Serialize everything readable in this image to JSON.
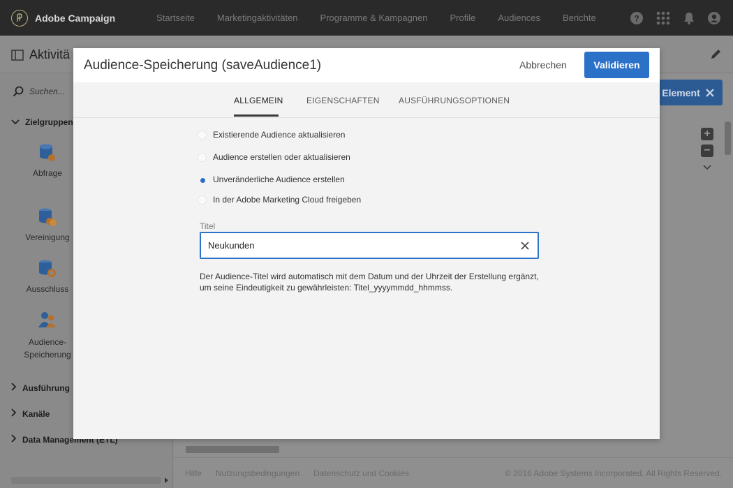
{
  "app": {
    "brand": "Adobe Campaign",
    "nav": [
      "Startseite",
      "Marketingaktivitäten",
      "Programme & Kampagnen",
      "Profile",
      "Audiences",
      "Berichte"
    ]
  },
  "background": {
    "page_title": "Aktivitä",
    "search_placeholder": "Suchen...",
    "sections": {
      "targeting": "Zielgruppenb",
      "execution": "Ausführung",
      "channels": "Kanäle",
      "data_management": "Data Management (ETL)"
    },
    "palette": {
      "query": "Abfrage",
      "union": "Vereinigung",
      "exclusion": "Ausschluss",
      "save_audience_line1": "Audience-",
      "save_audience_line2": "Speicherung"
    },
    "element_button": "Element",
    "footer": {
      "help": "Hilfe",
      "terms": "Nutzungsbedingungen",
      "privacy": "Datenschutz und Cookies",
      "copyright": "© 2016 Adobe Systems Incorporated. All Rights Reserved."
    }
  },
  "modal": {
    "title": "Audience-Speicherung (saveAudience1)",
    "cancel_label": "Abbrechen",
    "validate_label": "Validieren",
    "tabs": [
      "ALLGEMEIN",
      "EIGENSCHAFTEN",
      "AUSFÜHRUNGSOPTIONEN"
    ],
    "active_tab": "ALLGEMEIN",
    "options": [
      {
        "label": "Existierende Audience aktualisieren",
        "checked": false
      },
      {
        "label": "Audience erstellen oder aktualisieren",
        "checked": false
      },
      {
        "label": "Unveränderliche Audience erstellen",
        "checked": true
      },
      {
        "label": "In der Adobe Marketing Cloud freigeben",
        "checked": false
      }
    ],
    "title_field": {
      "label": "Titel",
      "value": "Neukunden"
    },
    "help_line1": "Der Audience-Titel wird automatisch mit dem Datum und der Uhrzeit der Erstellung ergänzt,",
    "help_line2": "um seine Eindeutigkeit zu gewährleisten: Titel_yyyymmdd_hhmmss."
  },
  "colors": {
    "accent": "#2c71c8",
    "topbar": "#2a2a2a"
  }
}
